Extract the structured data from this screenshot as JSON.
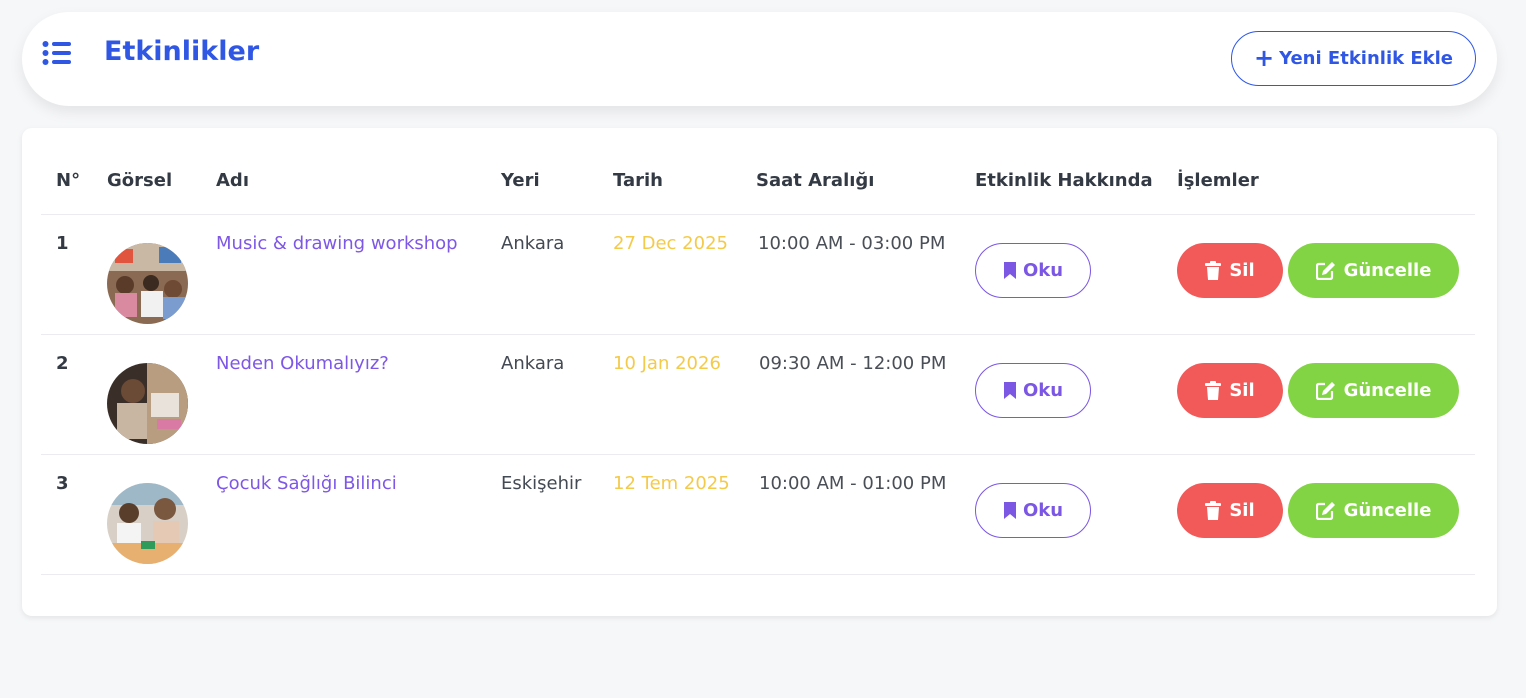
{
  "header": {
    "title": "Etkinlikler",
    "add_button_label": "Yeni Etkinlik Ekle",
    "menu_icon": "list-icon",
    "add_icon": "plus-icon"
  },
  "table": {
    "columns": [
      "N°",
      "Görsel",
      "Adı",
      "Yeri",
      "Tarih",
      "Saat Aralığı",
      "Etkinlik Hakkında",
      "İşlemler"
    ],
    "rows": [
      {
        "no": "1",
        "name": "Music & drawing workshop",
        "place": "Ankara",
        "date": "27 Dec 2025",
        "time": "10:00 AM - 03:00 PM",
        "read_label": "Oku",
        "delete_label": "Sil",
        "update_label": "Güncelle"
      },
      {
        "no": "2",
        "name": "Neden Okumalıyız?",
        "place": "Ankara",
        "date": "10 Jan 2026",
        "time": "09:30 AM - 12:00 PM",
        "read_label": "Oku",
        "delete_label": "Sil",
        "update_label": "Güncelle"
      },
      {
        "no": "3",
        "name": "Çocuk Sağlığı Bilinci",
        "place": "Eskişehir",
        "date": "12 Tem 2025",
        "time": "10:00 AM - 01:00 PM",
        "read_label": "Oku",
        "delete_label": "Sil",
        "update_label": "Güncelle"
      }
    ]
  },
  "icons": {
    "read": "bookmark-icon",
    "delete": "trash-icon",
    "update": "edit-icon"
  },
  "colors": {
    "primary": "#2f57e4",
    "link": "#7e57e6",
    "date": "#f4ca4a",
    "delete": "#f25a5a",
    "update": "#83d444",
    "background": "#f6f7f9"
  }
}
